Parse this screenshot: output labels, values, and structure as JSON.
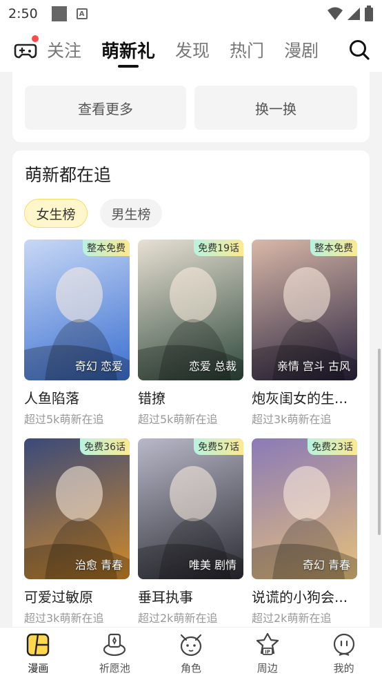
{
  "status_bar": {
    "time": "2:50"
  },
  "top_nav": {
    "tabs": [
      {
        "label": "关注"
      },
      {
        "label": "萌新礼"
      },
      {
        "label": "发现"
      },
      {
        "label": "热门"
      },
      {
        "label": "漫剧"
      }
    ],
    "active_tab": "萌新礼"
  },
  "upper_card": {
    "more_label": "查看更多",
    "swap_label": "换一换"
  },
  "section": {
    "title": "萌新都在追",
    "filters": [
      {
        "label": "女生榜",
        "active": true
      },
      {
        "label": "男生榜",
        "active": false
      }
    ],
    "books": [
      {
        "title": "人鱼陷落",
        "badge": "整本免费",
        "genre": "奇幻 恋爱",
        "readers": "超过5k萌新在追",
        "colors": [
          "#3a6fd0",
          "#c8d8f6"
        ]
      },
      {
        "title": "错撩",
        "badge": "免费19话",
        "genre": "恋爱 总裁",
        "readers": "超过5k萌新在追",
        "colors": [
          "#2f4a3c",
          "#e8e0d4"
        ]
      },
      {
        "title": "炮灰闺女的生...",
        "badge": "整本免费",
        "genre": "亲情 宫斗 古风",
        "readers": "超过3k萌新在追",
        "colors": [
          "#2a2440",
          "#d9b8a8"
        ]
      },
      {
        "title": "可爱过敏原",
        "badge": "免费36话",
        "genre": "治愈 青春",
        "readers": "超过3k萌新在追",
        "colors": [
          "#d08a2a",
          "#3a4a7a"
        ]
      },
      {
        "title": "垂耳执事",
        "badge": "免费57话",
        "genre": "唯美 剧情",
        "readers": "超过2k萌新在追",
        "colors": [
          "#2c2c34",
          "#b8b8c8"
        ]
      },
      {
        "title": "说谎的小狗会...",
        "badge": "免费23话",
        "genre": "奇幻 青春",
        "readers": "超过2k萌新在追",
        "colors": [
          "#e6c07a",
          "#8a7ab8"
        ]
      }
    ]
  },
  "bottom_nav": {
    "items": [
      {
        "label": "漫画",
        "icon": "comic-icon",
        "active": true
      },
      {
        "label": "祈愿池",
        "icon": "wish-pool-icon",
        "active": false
      },
      {
        "label": "角色",
        "icon": "character-icon",
        "active": false
      },
      {
        "label": "周边",
        "icon": "merch-icon",
        "active": false
      },
      {
        "label": "我的",
        "icon": "profile-icon",
        "active": false
      }
    ]
  },
  "colors": {
    "accent_yellow": "#ffd84d",
    "notification_dot": "#ff4b4b"
  }
}
